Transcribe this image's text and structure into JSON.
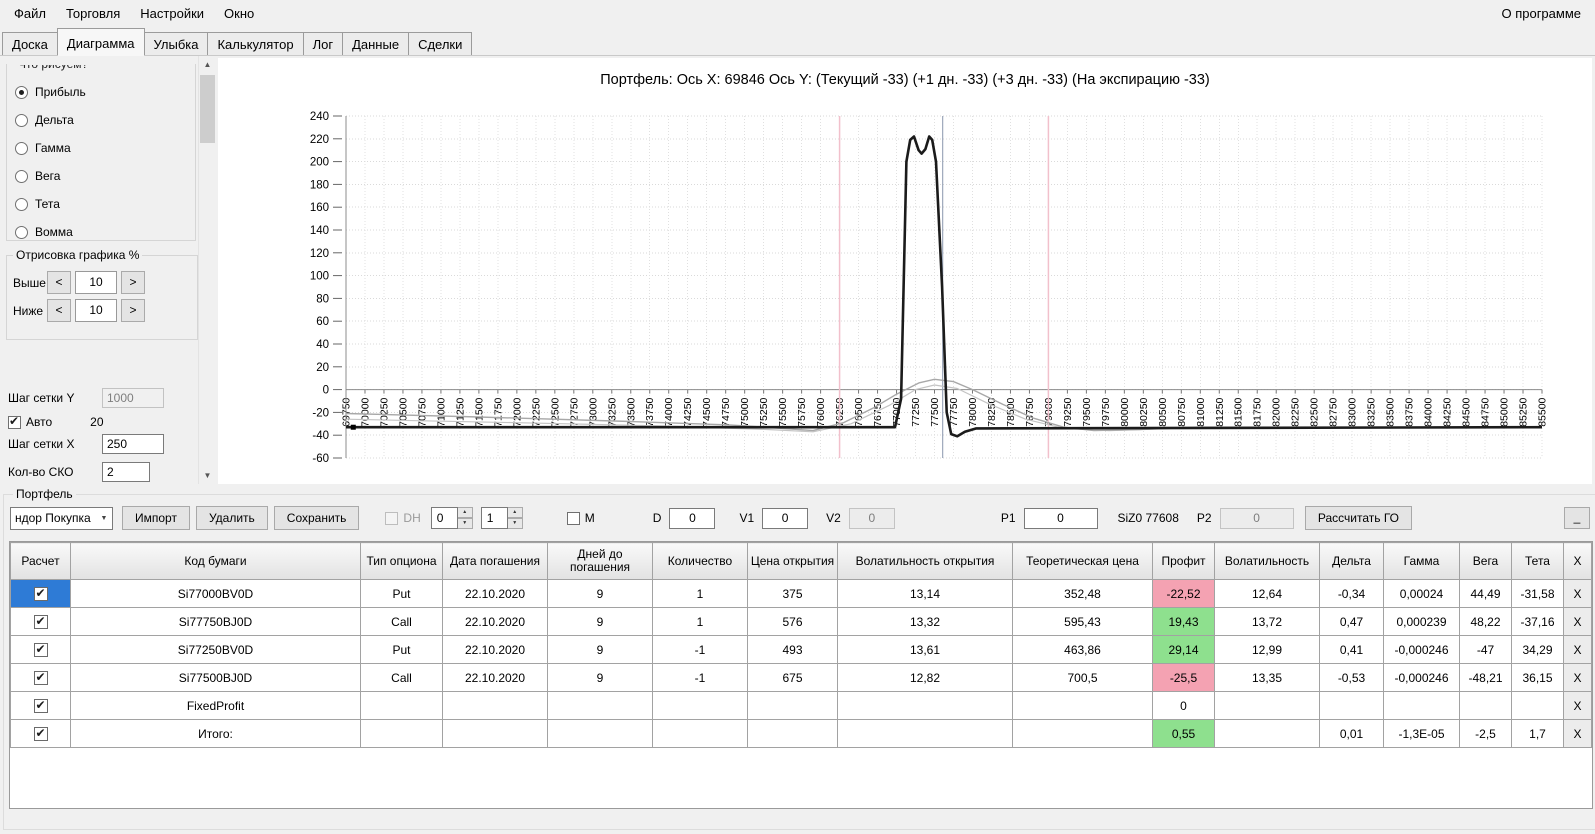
{
  "menu": {
    "items": [
      "Файл",
      "Торговля",
      "Настройки",
      "Окно"
    ],
    "right": "О программе"
  },
  "tabs": {
    "items": [
      "Доска",
      "Диаграмма",
      "Улыбка",
      "Калькулятор",
      "Лог",
      "Данные",
      "Сделки"
    ],
    "active": "Диаграмма"
  },
  "left_panel": {
    "clipped_group_label": "Что рисуем?",
    "radios": [
      {
        "label": "Прибыль",
        "checked": true
      },
      {
        "label": "Дельта",
        "checked": false
      },
      {
        "label": "Гамма",
        "checked": false
      },
      {
        "label": "Вега",
        "checked": false
      },
      {
        "label": "Тета",
        "checked": false
      },
      {
        "label": "Вомма",
        "checked": false
      }
    ],
    "draw_group": {
      "title": "Отрисовка графика %",
      "rows": [
        {
          "label": "Выше",
          "dec": "<",
          "value": "10",
          "inc": ">"
        },
        {
          "label": "Ниже",
          "dec": "<",
          "value": "10",
          "inc": ">"
        }
      ]
    },
    "grid_y": {
      "label": "Шаг сетки Y",
      "value": "1000"
    },
    "auto": {
      "label": "Авто",
      "checked": true,
      "extra": "20"
    },
    "grid_x": {
      "label": "Шаг сетки X",
      "value": "250"
    },
    "sko": {
      "label": "Кол-во СКО",
      "value": "2"
    }
  },
  "chart_data": {
    "type": "line",
    "title": "Портфель: Ось X: 69846 Ось Y: (Текущий -33) (+1 дн. -33) (+3 дн. -33) (На экспирацию -33)",
    "x_min": 69750,
    "x_max": 85500,
    "x_tick_step": 250,
    "y_min": -60,
    "y_max": 240,
    "y_tick_step": 20,
    "grid": true,
    "legend": "none",
    "series": [
      {
        "name": "На экспирацию",
        "color": "#1b1b1b",
        "width": 2.6,
        "points": [
          [
            69750,
            -33
          ],
          [
            76980,
            -33
          ],
          [
            77060,
            -8
          ],
          [
            77130,
            200
          ],
          [
            77180,
            219
          ],
          [
            77230,
            222
          ],
          [
            77290,
            210
          ],
          [
            77330,
            207
          ],
          [
            77380,
            211
          ],
          [
            77430,
            222
          ],
          [
            77470,
            219
          ],
          [
            77520,
            200
          ],
          [
            77600,
            90
          ],
          [
            77660,
            -20
          ],
          [
            77720,
            -39
          ],
          [
            77800,
            -41
          ],
          [
            77900,
            -37
          ],
          [
            78050,
            -34
          ],
          [
            85500,
            -33
          ]
        ]
      },
      {
        "name": "Текущий",
        "color": "#a8a8a8",
        "width": 1.4,
        "points": [
          [
            69750,
            -21
          ],
          [
            71500,
            -24
          ],
          [
            73500,
            -28
          ],
          [
            74800,
            -31
          ],
          [
            75500,
            -34
          ],
          [
            75900,
            -36
          ],
          [
            76300,
            -29
          ],
          [
            76700,
            -16
          ],
          [
            77000,
            -4
          ],
          [
            77300,
            6
          ],
          [
            77500,
            9
          ],
          [
            77750,
            7
          ],
          [
            78000,
            0
          ],
          [
            78400,
            -13
          ],
          [
            78800,
            -25
          ],
          [
            79200,
            -33
          ],
          [
            79600,
            -36
          ],
          [
            80200,
            -35
          ],
          [
            81000,
            -33
          ],
          [
            82500,
            -33
          ],
          [
            85500,
            -33
          ]
        ]
      },
      {
        "name": "+3 дн.",
        "color": "#c4c4c4",
        "width": 1.2,
        "points": [
          [
            69750,
            -26
          ],
          [
            72000,
            -29
          ],
          [
            74000,
            -32
          ],
          [
            75300,
            -35
          ],
          [
            75900,
            -37
          ],
          [
            76400,
            -30
          ],
          [
            76900,
            -14
          ],
          [
            77250,
            0
          ],
          [
            77500,
            4
          ],
          [
            77800,
            1
          ],
          [
            78200,
            -12
          ],
          [
            78700,
            -26
          ],
          [
            79200,
            -34
          ],
          [
            79800,
            -36
          ],
          [
            80600,
            -34
          ],
          [
            82000,
            -33
          ],
          [
            85500,
            -33
          ]
        ]
      }
    ],
    "vlines": [
      {
        "x": 76250,
        "color": "#f2c0cc",
        "width": 1.5
      },
      {
        "x": 79000,
        "color": "#f2c0cc",
        "width": 1.5
      },
      {
        "x": 77608,
        "color": "#8a97ad",
        "width": 1
      }
    ],
    "marker": {
      "x": 69846,
      "y": -33,
      "color": "#000000"
    }
  },
  "colors": {
    "selection": "#2e7bd6",
    "profit_pos": "#8ee08e",
    "profit_neg": "#f4a2b2"
  },
  "portfolio": {
    "group_title": "Портфель",
    "toolbar": {
      "combo_value": "ндор Покупка",
      "import_label": "Импорт",
      "delete_label": "Удалить",
      "save_label": "Сохранить",
      "dh_label": "DH",
      "spin1_value": "0",
      "spin2_value": "1",
      "m_label": "М",
      "d_label": "D",
      "d_value": "0",
      "v1_label": "V1",
      "v1_value": "0",
      "v2_label": "V2",
      "v2_value": "0",
      "p1_label": "P1",
      "p1_value": "0",
      "instrument_label": "SiZ0 77608",
      "p2_label": "P2",
      "p2_value": "0",
      "calc_go_label": "Рассчитать ГО",
      "collapse_label": "_"
    },
    "table": {
      "x_button": "X",
      "columns": [
        "Расчет",
        "Код бумаги",
        "Тип опциона",
        "Дата погашения",
        "Дней до погашения",
        "Количество",
        "Цена открытия",
        "Волатильность открытия",
        "Теоретическая цена",
        "Профит",
        "Волатильность",
        "Дельта",
        "Гамма",
        "Вега",
        "Тета",
        "X"
      ],
      "rows": [
        {
          "checked": true,
          "selected": true,
          "code": "Si77000BV0D",
          "option_type": "Put",
          "expiry": "22.10.2020",
          "days": "9",
          "qty": "1",
          "open_price": "375",
          "open_vol": "13,14",
          "theor_price": "352,48",
          "profit": "-22,52",
          "profit_state": "neg",
          "vol": "12,64",
          "delta": "-0,34",
          "gamma": "0,00024",
          "vega": "44,49",
          "theta": "-31,58"
        },
        {
          "checked": true,
          "selected": false,
          "code": "Si77750BJ0D",
          "option_type": "Call",
          "expiry": "22.10.2020",
          "days": "9",
          "qty": "1",
          "open_price": "576",
          "open_vol": "13,32",
          "theor_price": "595,43",
          "profit": "19,43",
          "profit_state": "pos",
          "vol": "13,72",
          "delta": "0,47",
          "gamma": "0,000239",
          "vega": "48,22",
          "theta": "-37,16"
        },
        {
          "checked": true,
          "selected": false,
          "code": "Si77250BV0D",
          "option_type": "Put",
          "expiry": "22.10.2020",
          "days": "9",
          "qty": "-1",
          "open_price": "493",
          "open_vol": "13,61",
          "theor_price": "463,86",
          "profit": "29,14",
          "profit_state": "pos",
          "vol": "12,99",
          "delta": "0,41",
          "gamma": "-0,000246",
          "vega": "-47",
          "theta": "34,29"
        },
        {
          "checked": true,
          "selected": false,
          "code": "Si77500BJ0D",
          "option_type": "Call",
          "expiry": "22.10.2020",
          "days": "9",
          "qty": "-1",
          "open_price": "675",
          "open_vol": "12,82",
          "theor_price": "700,5",
          "profit": "-25,5",
          "profit_state": "neg",
          "vol": "13,35",
          "delta": "-0,53",
          "gamma": "-0,000246",
          "vega": "-48,21",
          "theta": "36,15"
        },
        {
          "checked": true,
          "selected": false,
          "code": "FixedProfit",
          "option_type": "",
          "expiry": "",
          "days": "",
          "qty": "",
          "open_price": "",
          "open_vol": "",
          "theor_price": "",
          "profit": "0",
          "profit_state": "none",
          "vol": "",
          "delta": "",
          "gamma": "",
          "vega": "",
          "theta": ""
        },
        {
          "checked": true,
          "selected": false,
          "code": "Итого:",
          "option_type": "",
          "expiry": "",
          "days": "",
          "qty": "",
          "open_price": "",
          "open_vol": "",
          "theor_price": "",
          "profit": "0,55",
          "profit_state": "pos",
          "vol": "",
          "delta": "0,01",
          "gamma": "-1,3E-05",
          "vega": "-2,5",
          "theta": "1,7"
        }
      ]
    }
  }
}
